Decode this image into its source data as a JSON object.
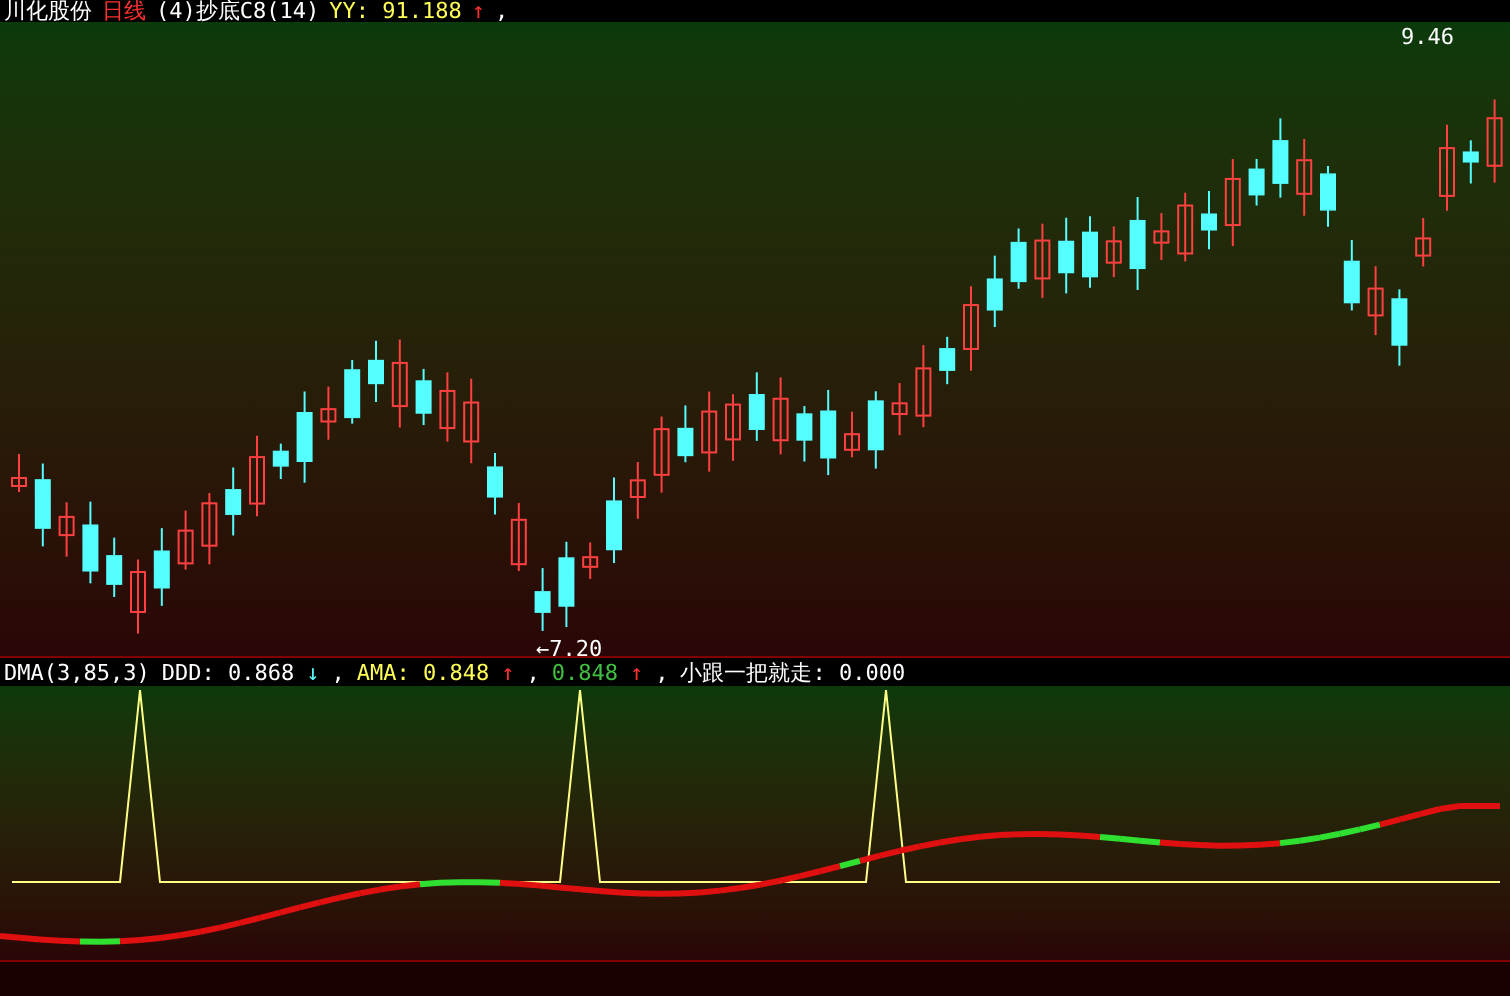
{
  "main_header": [
    {
      "text": "川化股份",
      "color": "#ffffff"
    },
    {
      "text": "日线",
      "color": "#ff3030"
    },
    {
      "text": "(4)抄底C8(14)",
      "color": "#ffffff"
    },
    {
      "text": "YY: 91.188",
      "color": "#ffff55"
    },
    {
      "text": "↑",
      "color": "#ff3030"
    },
    {
      "text": ",",
      "color": "#ffffff"
    }
  ],
  "max_price_label": "9.46",
  "min_price_label": {
    "arrow": "←",
    "value": "7.20"
  },
  "indicator_header": [
    {
      "text": "DMA(3,85,3)",
      "color": "#ffffff"
    },
    {
      "text": "DDD: 0.868",
      "color": "#ffffff"
    },
    {
      "text": "↓",
      "color": "#55ffff"
    },
    {
      "text": ",",
      "color": "#ffffff"
    },
    {
      "text": "AMA: 0.848",
      "color": "#ffff55"
    },
    {
      "text": "↑",
      "color": "#ff3030"
    },
    {
      "text": ",",
      "color": "#ffffff"
    },
    {
      "text": "0.848",
      "color": "#40c040"
    },
    {
      "text": "↑",
      "color": "#ff3030"
    },
    {
      "text": ",",
      "color": "#ffffff"
    },
    {
      "text": "小跟一把就走: 0.000",
      "color": "#ffffff"
    }
  ]
}
